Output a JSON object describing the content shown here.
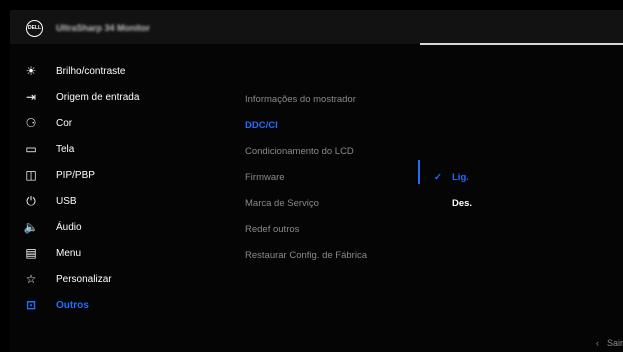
{
  "header": {
    "logo": "DELL",
    "model": "UltraSharp 34 Monitor"
  },
  "menu": [
    {
      "label": "Brilho/contraste",
      "icon": "brightness-icon",
      "glyph": "☀"
    },
    {
      "label": "Origem de entrada",
      "icon": "input-source-icon",
      "glyph": "⇥"
    },
    {
      "label": "Cor",
      "icon": "palette-icon",
      "glyph": "⚆"
    },
    {
      "label": "Tela",
      "icon": "display-icon",
      "glyph": "▭"
    },
    {
      "label": "PIP/PBP",
      "icon": "pip-icon",
      "glyph": "◫"
    },
    {
      "label": "USB",
      "icon": "usb-icon",
      "glyph": "⏻"
    },
    {
      "label": "Áudio",
      "icon": "speaker-icon",
      "glyph": "🔈"
    },
    {
      "label": "Menu",
      "icon": "menu-icon",
      "glyph": "▤"
    },
    {
      "label": "Personalizar",
      "icon": "star-icon",
      "glyph": "☆"
    },
    {
      "label": "Outros",
      "icon": "others-icon",
      "glyph": "⊡"
    }
  ],
  "submenu": [
    "Informações do mostrador",
    "DDC/CI",
    "Condicionamento do LCD",
    "Firmware",
    "Marca de Serviço",
    "Redef outros",
    "Restaurar Config. de Fábrica"
  ],
  "options": [
    {
      "label": "Lig.",
      "check": "✓"
    },
    {
      "label": "Des.",
      "check": ""
    }
  ],
  "footer": {
    "arrow": "‹",
    "exit": "Sair"
  },
  "colors": {
    "accent": "#1f6fff",
    "background": "#050505"
  }
}
